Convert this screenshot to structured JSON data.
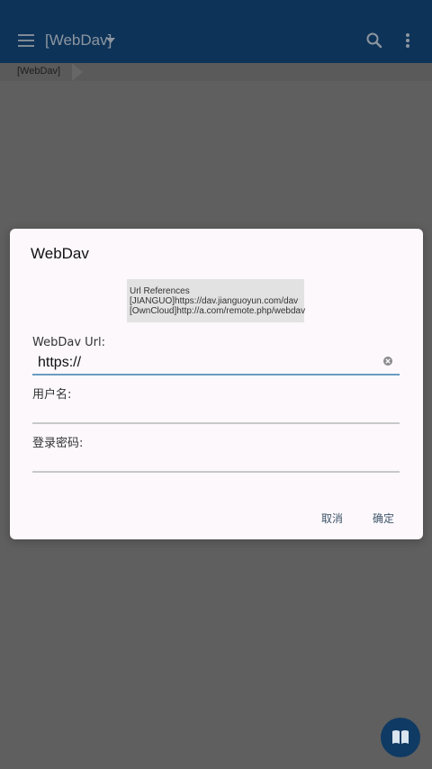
{
  "app_bar": {
    "title": "[WebDav]",
    "menu_icon": "hamburger-menu-icon",
    "dropdown_icon": "dropdown-arrow-icon",
    "search_icon": "search-icon",
    "more_icon": "more-vert-icon"
  },
  "breadcrumb": {
    "items": [
      "[WebDav]"
    ]
  },
  "dialog": {
    "title": "WebDav",
    "references": {
      "heading": "Url References",
      "lines": [
        "[JIANGUO]https://dav.jianguoyun.com/dav",
        "[OwnCloud]http://a.com/remote.php/webdav"
      ]
    },
    "url_field": {
      "label": "WebDav Url:",
      "value": "https://"
    },
    "username_field": {
      "label": "用户名:",
      "value": ""
    },
    "password_field": {
      "label": "登录密码:",
      "value": ""
    },
    "cancel_label": "取消",
    "confirm_label": "确定"
  },
  "fab": {
    "icon": "open-book-icon"
  },
  "colors": {
    "scrim": "#5f5f5f",
    "app_bar": "#0e3358",
    "dialog_bg": "#fcf8fc",
    "focus_underline": "#6a9cbf",
    "button_text": "#3e5568",
    "fab": "#0f3a63"
  }
}
